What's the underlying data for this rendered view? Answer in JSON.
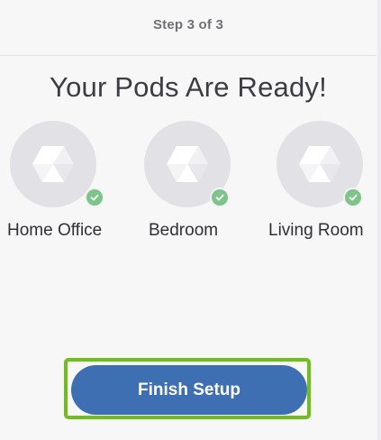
{
  "header": {
    "step": "Step 3 of 3"
  },
  "title": "Your Pods Are Ready!",
  "pods": [
    {
      "label": "Home Office",
      "status": "ready"
    },
    {
      "label": "Bedroom",
      "status": "ready"
    },
    {
      "label": "Living Room",
      "status": "ready"
    }
  ],
  "finish": {
    "label": "Finish Setup"
  },
  "colors": {
    "accent_button": "#3f6fb3",
    "highlight_frame": "#6fbf1a",
    "check": "#7cc48a"
  }
}
